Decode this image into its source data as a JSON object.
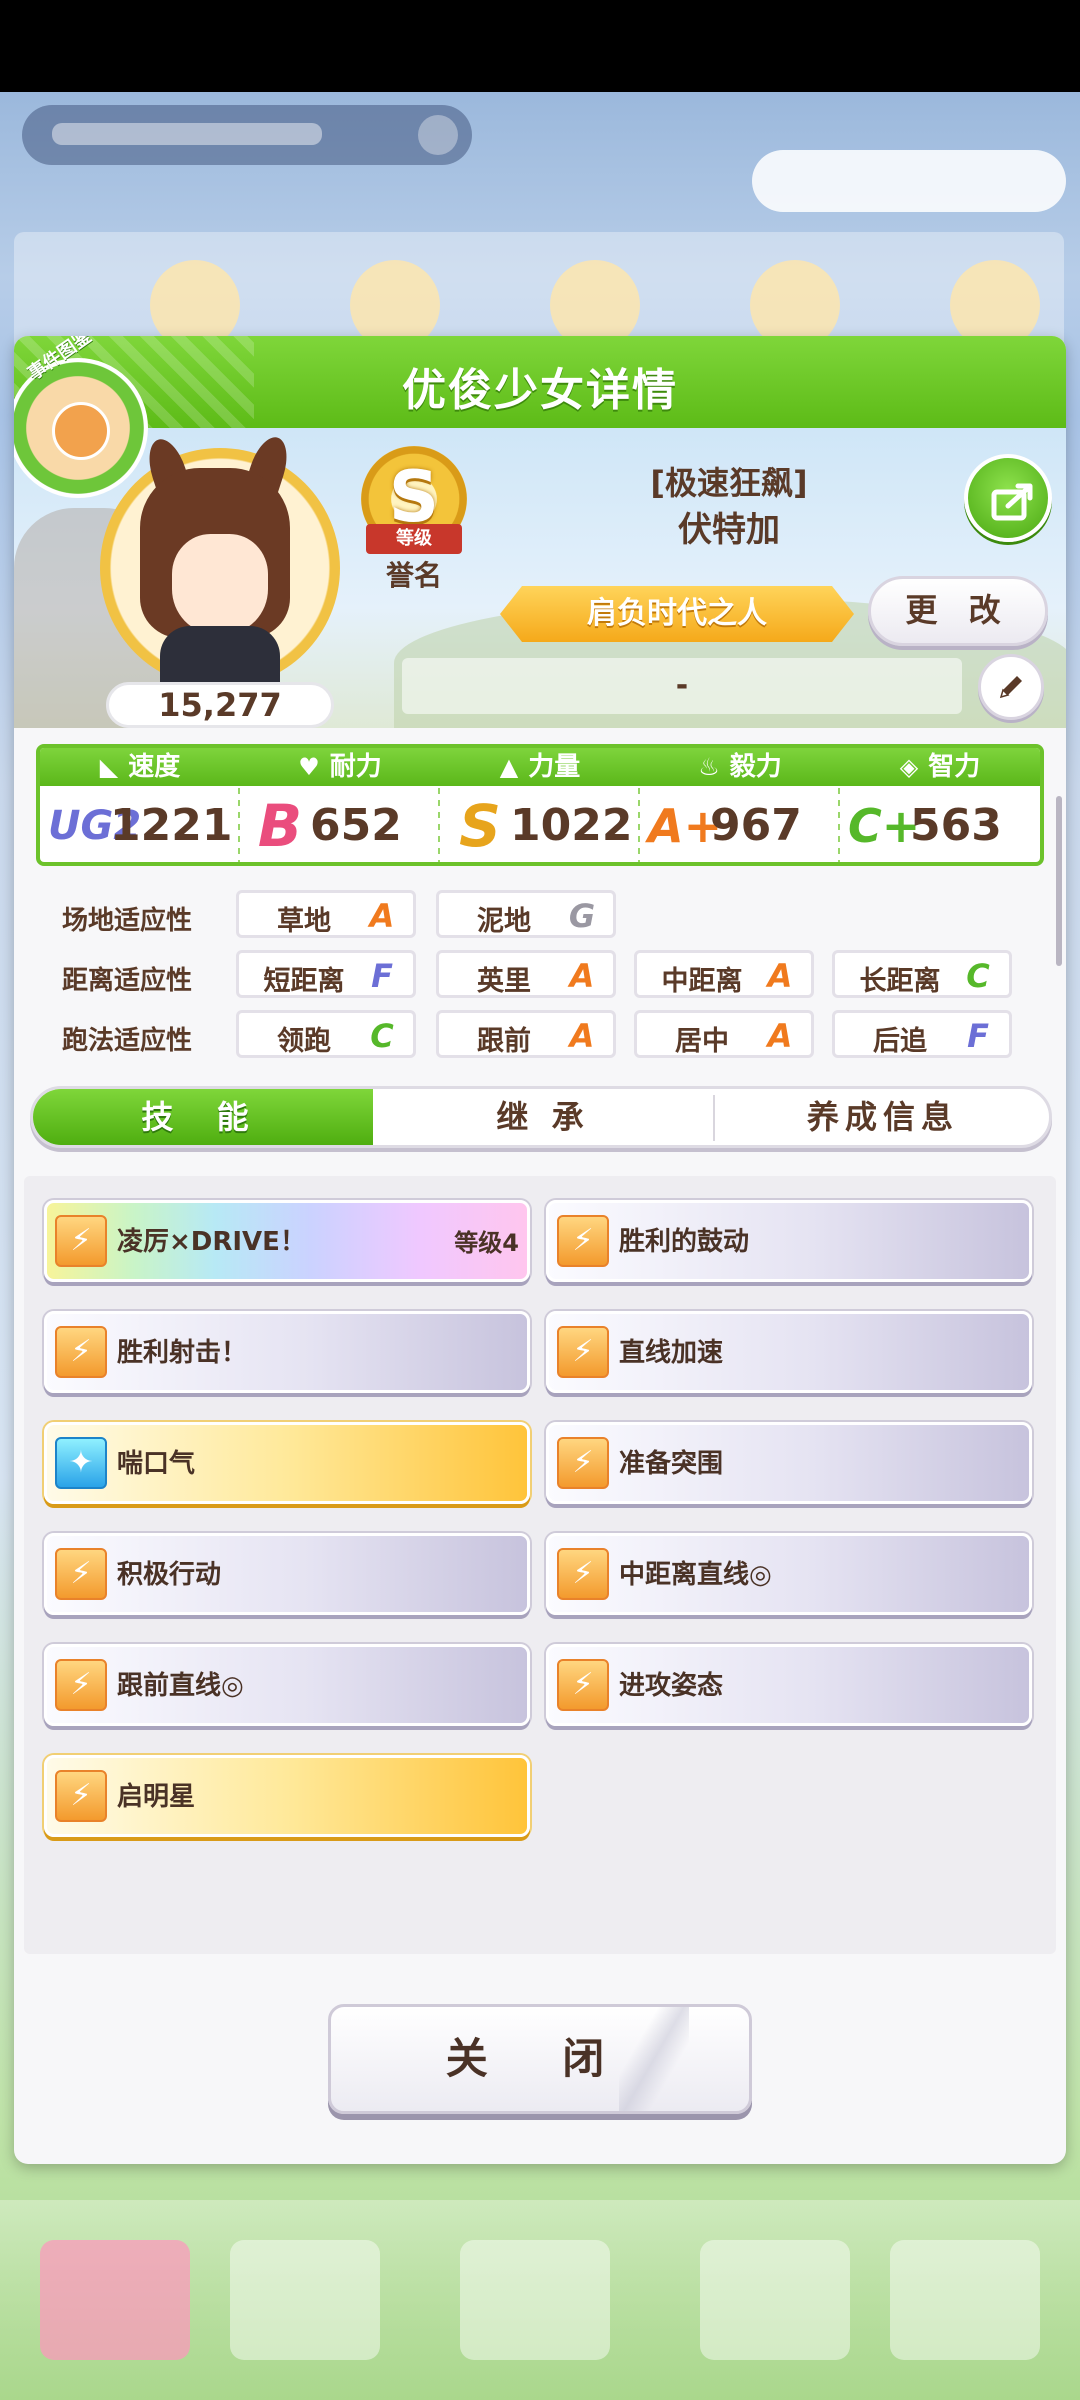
{
  "dialog": {
    "title": "优俊少女详情",
    "event_badge": "事件图鉴"
  },
  "profile": {
    "score": "15,277",
    "rank_letter": "S",
    "rank_ribbon": "等级",
    "rank_label": "誉名",
    "costume_title": "[极速狂飙]",
    "name": "伏特加",
    "epithet": "肩负时代之人",
    "change_label": "更 改",
    "subtitle": "-"
  },
  "stats": [
    {
      "label": "速度",
      "icon": "shoe-icon",
      "glyph": "◣",
      "grade": "UG2",
      "value": "1221",
      "color": "#6c6fd6"
    },
    {
      "label": "耐力",
      "icon": "heart-icon",
      "glyph": "♥",
      "grade": "B",
      "value": "652",
      "color": "#ea4d7d"
    },
    {
      "label": "力量",
      "icon": "muscle-icon",
      "glyph": "▲",
      "grade": "S",
      "value": "1022",
      "color": "#e7a41c"
    },
    {
      "label": "毅力",
      "icon": "flame-icon",
      "glyph": "♨",
      "grade": "A+",
      "value": "967",
      "color": "#f07a1e"
    },
    {
      "label": "智力",
      "icon": "graduation-cap-icon",
      "glyph": "◈",
      "grade": "C+",
      "value": "563",
      "color": "#56b82a"
    }
  ],
  "aptitude": {
    "rows": [
      {
        "label": "场地适应性",
        "items": [
          {
            "name": "草地",
            "grade": "A"
          },
          {
            "name": "泥地",
            "grade": "G"
          }
        ]
      },
      {
        "label": "距离适应性",
        "items": [
          {
            "name": "短距离",
            "grade": "F"
          },
          {
            "name": "英里",
            "grade": "A"
          },
          {
            "name": "中距离",
            "grade": "A"
          },
          {
            "name": "长距离",
            "grade": "C"
          }
        ]
      },
      {
        "label": "跑法适应性",
        "items": [
          {
            "name": "领跑",
            "grade": "C"
          },
          {
            "name": "跟前",
            "grade": "A"
          },
          {
            "name": "居中",
            "grade": "A"
          },
          {
            "name": "后追",
            "grade": "F"
          }
        ]
      }
    ],
    "grade_colors": {
      "A": "#f07a1e",
      "C": "#56b82a",
      "F": "#6c6fd6",
      "G": "#9a98a2"
    }
  },
  "tabs": [
    "技 能",
    "继 承",
    "养成信息"
  ],
  "skills": [
    {
      "name": "凌厉×DRIVE！",
      "level": "等级4",
      "style": "rainbow",
      "icon": "speed-skill-icon"
    },
    {
      "name": "胜利的鼓动",
      "level": "",
      "style": "normal",
      "icon": "speed-skill-icon"
    },
    {
      "name": "胜利射击！",
      "level": "",
      "style": "normal",
      "icon": "speed-skill-icon"
    },
    {
      "name": "直线加速",
      "level": "",
      "style": "normal",
      "icon": "speed-skill-icon"
    },
    {
      "name": "喘口气",
      "level": "",
      "style": "gold",
      "icon": "sparkle-skill-icon"
    },
    {
      "name": "准备突围",
      "level": "",
      "style": "normal",
      "icon": "speed-skill-icon"
    },
    {
      "name": "积极行动",
      "level": "",
      "style": "normal",
      "icon": "speed-skill-icon"
    },
    {
      "name": "中距离直线◎",
      "level": "",
      "style": "normal",
      "icon": "speed-skill-icon"
    },
    {
      "name": "跟前直线◎",
      "level": "",
      "style": "normal",
      "icon": "speed-skill-icon"
    },
    {
      "name": "进攻姿态",
      "level": "",
      "style": "normal",
      "icon": "speed-skill-icon"
    },
    {
      "name": "启明星",
      "level": "",
      "style": "gold",
      "icon": "speed-skill-icon"
    }
  ],
  "close_label": "关 闭"
}
